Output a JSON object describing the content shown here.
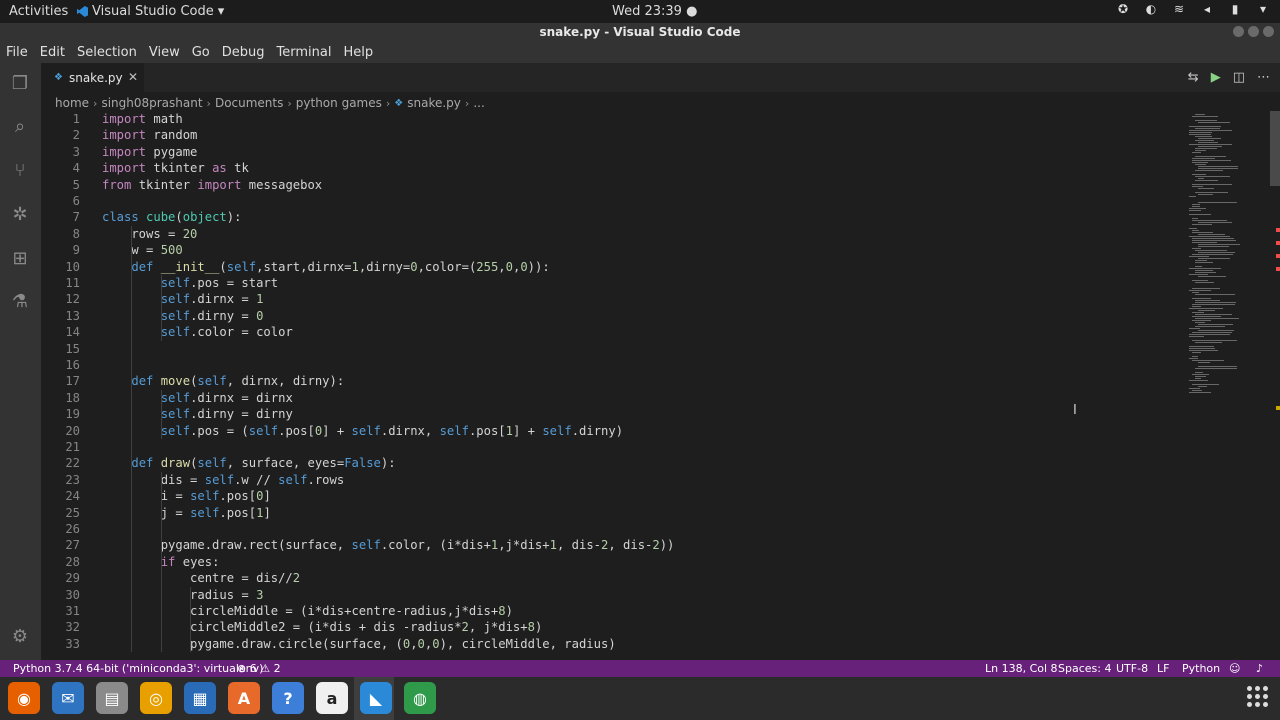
{
  "topbar": {
    "activities": "Activities",
    "app_name": "Visual Studio Code",
    "app_caret": "▾",
    "clock": "Wed 23:39 ●"
  },
  "window": {
    "title": "snake.py - Visual Studio Code"
  },
  "menu": [
    "File",
    "Edit",
    "Selection",
    "View",
    "Go",
    "Debug",
    "Terminal",
    "Help"
  ],
  "tab": {
    "label": "snake.py",
    "close": "✕"
  },
  "breadcrumb": [
    "home",
    "singh08prashant",
    "Documents",
    "python games",
    "snake.py",
    "..."
  ],
  "code": [
    "import math",
    "import random",
    "import pygame",
    "import tkinter as tk",
    "from tkinter import messagebox",
    "",
    "class cube(object):",
    "    rows = 20",
    "    w = 500",
    "    def __init__(self,start,dirnx=1,dirny=0,color=(255,0,0)):",
    "        self.pos = start",
    "        self.dirnx = 1",
    "        self.dirny = 0",
    "        self.color = color",
    "",
    "",
    "    def move(self, dirnx, dirny):",
    "        self.dirnx = dirnx",
    "        self.dirny = dirny",
    "        self.pos = (self.pos[0] + self.dirnx, self.pos[1] + self.dirny)",
    "",
    "    def draw(self, surface, eyes=False):",
    "        dis = self.w // self.rows",
    "        i = self.pos[0]",
    "        j = self.pos[1]",
    "",
    "        pygame.draw.rect(surface, self.color, (i*dis+1,j*dis+1, dis-2, dis-2))",
    "        if eyes:",
    "            centre = dis//2",
    "            radius = 3",
    "            circleMiddle = (i*dis+centre-radius,j*dis+8)",
    "            circleMiddle2 = (i*dis + dis -radius*2, j*dis+8)",
    "            pygame.draw.circle(surface, (0,0,0), circleMiddle, radius)"
  ],
  "status": {
    "interpreter": "Python 3.7.4 64-bit ('miniconda3': virtualenv)",
    "problems": "⊗ 6 ⚠ 2",
    "position": "Ln 138, Col 8",
    "spaces": "Spaces: 4",
    "encoding": "UTF-8",
    "eol": "LF",
    "language": "Python"
  },
  "dock": [
    {
      "name": "firefox-icon",
      "glyph": "◉",
      "color": "#e66000"
    },
    {
      "name": "thunderbird-icon",
      "glyph": "✉",
      "color": "#2f74c0"
    },
    {
      "name": "files-icon",
      "glyph": "▤",
      "color": "#8a8a8a"
    },
    {
      "name": "rhythmbox-icon",
      "glyph": "◎",
      "color": "#e8a000"
    },
    {
      "name": "writer-icon",
      "glyph": "▦",
      "color": "#2a6bb8"
    },
    {
      "name": "software-icon",
      "glyph": "A",
      "color": "#e86a2a"
    },
    {
      "name": "help-icon",
      "glyph": "?",
      "color": "#3c7ed8"
    },
    {
      "name": "amazon-icon",
      "glyph": "a",
      "color": "#f0f0f0"
    },
    {
      "name": "vscode-icon",
      "glyph": "◣",
      "color": "#2a8ad8"
    },
    {
      "name": "globe-icon",
      "glyph": "◍",
      "color": "#2f9a4a"
    }
  ],
  "colors": {
    "accent": "#68217a",
    "editor_bg": "#1e1e1e",
    "keyword": "#c586c0",
    "function": "#dcdcaa"
  }
}
